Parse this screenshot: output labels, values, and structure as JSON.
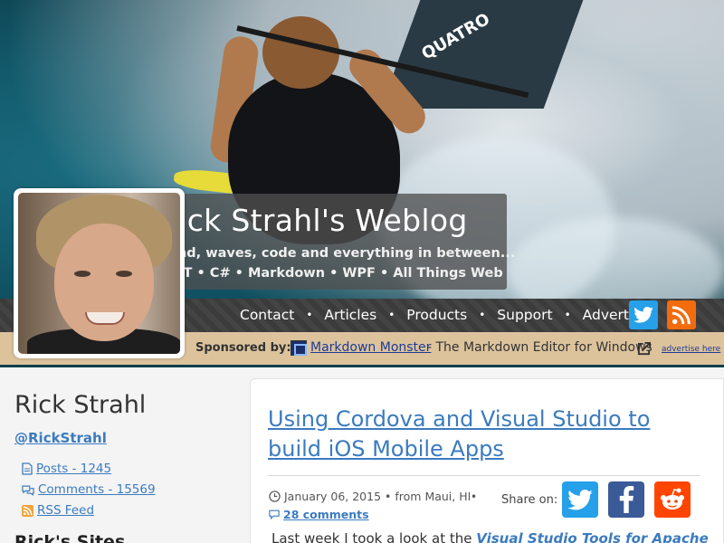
{
  "header": {
    "title": "Rick Strahl's Weblog",
    "tagline": "Wind, waves, code and everything in between...",
    "topics": ".NET • C# • Markdown • WPF • All Things Web",
    "sail_logo": "QUATRO"
  },
  "nav": {
    "items": [
      {
        "label": "Contact"
      },
      {
        "label": "Articles"
      },
      {
        "label": "Products"
      },
      {
        "label": "Support"
      },
      {
        "label": "Advertise"
      }
    ],
    "separator": "•",
    "icons": [
      "twitter-icon",
      "rss-icon"
    ],
    "colors": {
      "twitter": "#26a0e8",
      "rss": "#f26b0c"
    }
  },
  "sponsor": {
    "label": "Sponsored by:",
    "product": "Markdown Monster",
    "description": "- The Markdown Editor for Windows",
    "advertise": "advertise here"
  },
  "sidebar": {
    "author": "Rick Strahl",
    "handle": "@RickStrahl",
    "links": [
      {
        "icon": "document-icon",
        "label": "Posts - 1245"
      },
      {
        "icon": "comments-icon",
        "label": "Comments - 15569"
      },
      {
        "icon": "rss-icon",
        "label": "RSS Feed"
      }
    ],
    "sites_heading": "Rick's Sites"
  },
  "post": {
    "title": "Using Cordova and Visual Studio to build iOS Mobile Apps",
    "date": "January 06, 2015",
    "location": "• from Maui, HI",
    "bullet": "•",
    "comments": "28 comments",
    "share_label": "Share on:",
    "intro_prefix": "Last week I took a look at the ",
    "intro_link": "Visual Studio Tools for Apache"
  },
  "colors": {
    "link": "#3b7bbf",
    "sponsor_bar": "#dcc39c",
    "facebook": "#3a5a98",
    "reddit": "#ff4500"
  }
}
